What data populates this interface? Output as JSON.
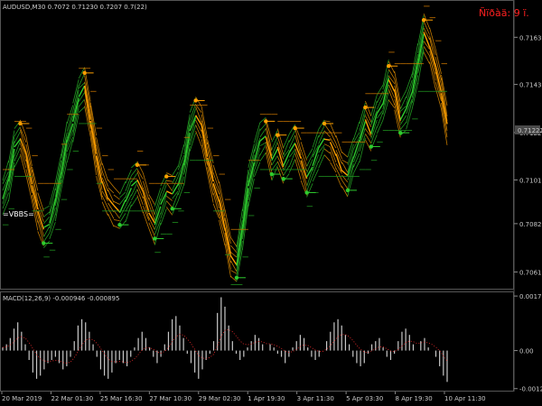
{
  "main_panel": {
    "title": "AUDUSD,M30  0.7072 0.71230 0.7207 0.7(22)",
    "signal_label": "Ñïðàä: 9 ï.",
    "indicator_label": "=VBBS=",
    "current_price": "0.71221"
  },
  "macd_panel": {
    "title": "MACD(12,26,9) -0.000946 -0.000895"
  },
  "colors": {
    "bullish": "#2ecc2e",
    "bearish": "#ffa000",
    "histogram": "#c8c8c8",
    "signal_text": "#ff2020"
  },
  "chart_data": [
    {
      "type": "line",
      "title": "AUDUSD,M30  0.7072 0.71230 0.7207 0.7(22)",
      "y_ticks": [
        "0.71635",
        "0.71430",
        "0.71221",
        "0.71015",
        "0.70825",
        "0.70615"
      ],
      "ylim": [
        0.7055,
        0.7175
      ],
      "x_ticks": [
        "20 Mar 2019",
        "22 Mar 01:30",
        "25 Mar 16:30",
        "27 Mar 10:30",
        "29 Mar 02:30",
        "1 Apr 19:30",
        "3 Apr 11:30",
        "5 Apr 03:30",
        "8 Apr 19:30",
        "10 Apr 11:30"
      ],
      "series": [
        {
          "values": [
            0.7094,
            0.7101,
            0.7115,
            0.712,
            0.7112,
            0.71,
            0.7088,
            0.708,
            0.7083,
            0.7092,
            0.7105,
            0.7118,
            0.7126,
            0.7138,
            0.7142,
            0.7128,
            0.7112,
            0.71,
            0.7094,
            0.709,
            0.7088,
            0.7092,
            0.7098,
            0.7102,
            0.7096,
            0.7088,
            0.7082,
            0.709,
            0.7097,
            0.7095,
            0.71,
            0.7108,
            0.7122,
            0.713,
            0.7125,
            0.7112,
            0.71,
            0.7092,
            0.7081,
            0.7068,
            0.7065,
            0.708,
            0.7098,
            0.711,
            0.7118,
            0.7121,
            0.711,
            0.7115,
            0.7108,
            0.7113,
            0.7118,
            0.711,
            0.7102,
            0.7108,
            0.7115,
            0.712,
            0.7118,
            0.7112,
            0.7106,
            0.7103,
            0.7112,
            0.7118,
            0.7127,
            0.7122,
            0.713,
            0.7135,
            0.7145,
            0.714,
            0.7128,
            0.7132,
            0.714,
            0.7152,
            0.7165,
            0.716,
            0.715,
            0.714,
            0.7125
          ]
        }
      ]
    },
    {
      "type": "bar",
      "title": "MACD(12,26,9) -0.000946 -0.000895",
      "y_ticks": [
        "0.001739",
        "0.00",
        "-0.001214"
      ],
      "ylim": [
        -0.00125,
        0.0018
      ],
      "series": [
        {
          "values": [
            0.0001,
            0.0002,
            0.0004,
            0.0007,
            0.0009,
            0.0006,
            0.0002,
            -0.0003,
            -0.0007,
            -0.0009,
            -0.0008,
            -0.0006,
            -0.0004,
            -0.0003,
            -0.0002,
            -0.0004,
            -0.0006,
            -0.0005,
            -0.0002,
            0.0003,
            0.0008,
            0.001,
            0.0009,
            0.0006,
            0.0002,
            -0.0002,
            -0.0006,
            -0.0008,
            -0.0009,
            -0.0007,
            -0.0004,
            -0.0003,
            -0.0004,
            -0.0005,
            -0.0002,
            0.0001,
            0.0004,
            0.0006,
            0.0004,
            0.0001,
            -0.0002,
            -0.0004,
            -0.0002,
            0.0002,
            0.0006,
            0.001,
            0.0011,
            0.0008,
            0.0004,
            -0.0001,
            -0.0004,
            -0.0007,
            -0.0009,
            -0.0006,
            -0.0003,
            -0.0001,
            0.0003,
            0.0012,
            0.0017,
            0.0014,
            0.0008,
            0.0003,
            -0.0001,
            -0.0003,
            -0.0002,
            0.0001,
            0.0003,
            0.0005,
            0.0004,
            0.0002,
            0.0,
            0.0002,
            0.0001,
            -0.0001,
            -0.0002,
            -0.0004,
            -0.0002,
            0.0001,
            0.0003,
            0.0005,
            0.0004,
            0.0001,
            -0.0002,
            -0.0003,
            -0.0002,
            0.0,
            0.0003,
            0.0006,
            0.0009,
            0.001,
            0.0008,
            0.0005,
            0.0002,
            -0.0002,
            -0.0004,
            -0.0005,
            -0.0004,
            -0.0001,
            0.0002,
            0.0003,
            0.0004,
            0.0001,
            -0.0002,
            -0.0003,
            -0.0001,
            0.0003,
            0.0006,
            0.0007,
            0.0005,
            0.0002,
            0.0,
            0.0003,
            0.0004,
            0.0001,
            0.0,
            -0.0002,
            -0.0005,
            -0.0008,
            -0.001
          ]
        }
      ]
    }
  ]
}
